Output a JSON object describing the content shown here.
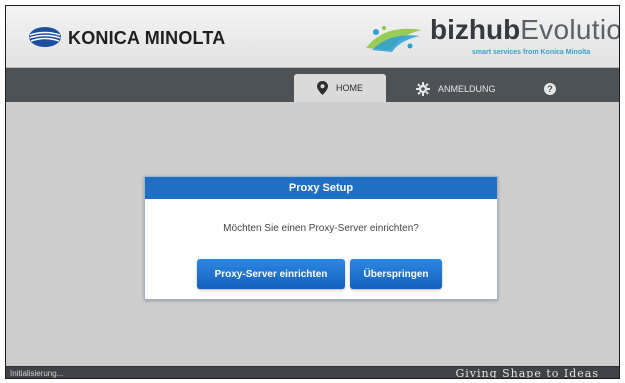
{
  "header": {
    "brand_name": "KONICA MINOLTA",
    "product_bold": "bizhub",
    "product_light": "Evolution",
    "product_tagline": "smart services from Konica Minolta"
  },
  "nav": {
    "tabs": [
      {
        "label": "HOME",
        "icon": "map-pin-icon",
        "active": true
      },
      {
        "label": "ANMELDUNG",
        "icon": "gear-icon",
        "active": false
      }
    ],
    "help_label": "?"
  },
  "dialog": {
    "title": "Proxy Setup",
    "message": "Möchten Sie einen Proxy-Server einrichten?",
    "primary_button": "Proxy-Server einrichten",
    "secondary_button": "Überspringen"
  },
  "footer": {
    "status": "Initialisierung...",
    "tagline": "Giving Shape to Ideas"
  },
  "colors": {
    "dialog_header": "#1f6fc5",
    "button": "#1a6dcb",
    "navbar": "#4d5257",
    "background": "#cdcdcd"
  }
}
